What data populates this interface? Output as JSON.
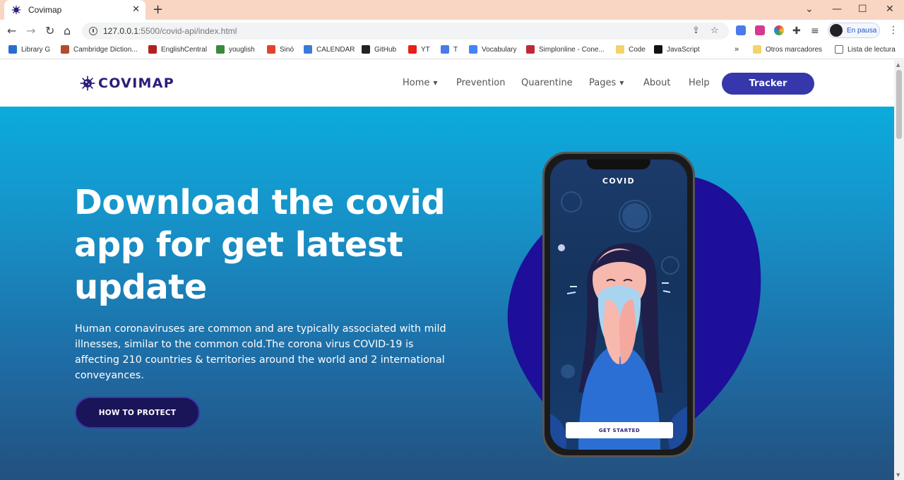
{
  "browser": {
    "tab_title": "Covimap",
    "tab_close": "✕",
    "new_tab": "+",
    "window_controls": {
      "minimize": "—",
      "maximize": "☐",
      "close": "✕",
      "tab_search": "⌄"
    },
    "url_host": "127.0.0.1",
    "url_rest": ":5500/covid-api/index.html",
    "profile_label": "En pausa",
    "nav": {
      "back": "←",
      "forward": "→",
      "reload": "↻",
      "home": "⌂",
      "share": "⇪",
      "star": "☆",
      "extensions": "✚",
      "reading_list": "≡",
      "menu": "⋮"
    }
  },
  "bookmarks": {
    "items": [
      {
        "label": "Library G",
        "color": "#2b6cd1"
      },
      {
        "label": "Cambridge Diction...",
        "color": "#b34b2e"
      },
      {
        "label": "EnglishCentral",
        "color": "#b32020"
      },
      {
        "label": "youglish",
        "color": "#3a8a3a"
      },
      {
        "label": "Sinó",
        "color": "#e0442a"
      },
      {
        "label": "CALENDAR",
        "color": "#3a7bd5"
      },
      {
        "label": "GitHub",
        "color": "#222222"
      },
      {
        "label": "YT",
        "color": "#e62117"
      },
      {
        "label": "T",
        "color": "#4a7be8"
      },
      {
        "label": "Vocabulary",
        "color": "#4285f4"
      },
      {
        "label": "Simplonline - Cone...",
        "color": "#c0283a"
      },
      {
        "label": "Code",
        "color": "#f5d36b"
      },
      {
        "label": "JavaScript",
        "color": "#111111"
      }
    ],
    "overflow": "»",
    "others": "Otros marcadores",
    "reading_list": "Lista de lectura"
  },
  "site": {
    "logo": "COVIMAP",
    "menu": [
      {
        "label": "Home",
        "caret": true
      },
      {
        "label": "Prevention",
        "caret": false
      },
      {
        "label": "Quarentine",
        "caret": false
      },
      {
        "label": "Pages",
        "caret": true
      },
      {
        "label": "About",
        "caret": false
      },
      {
        "label": "Help",
        "caret": false
      }
    ],
    "caret_glyph": "▼",
    "tracker_label": "Tracker"
  },
  "hero": {
    "title": "Download the covid app for get latest update",
    "description": "Human coronaviruses are common and are typically associated with mild illnesses, similar to the common cold.The corona virus COVID-19 is affecting 210 countries & territories around the world and 2 international conveyances.",
    "cta_label": "HOW TO PROTECT",
    "phone_title": "COVID",
    "phone_cta": "GET STARTED"
  },
  "colors": {
    "brand": "#2a1e7a",
    "tracker": "#3537ab",
    "blob": "#1d0f9a",
    "hero_top": "#0cabdc",
    "hero_bottom": "#22517f"
  }
}
